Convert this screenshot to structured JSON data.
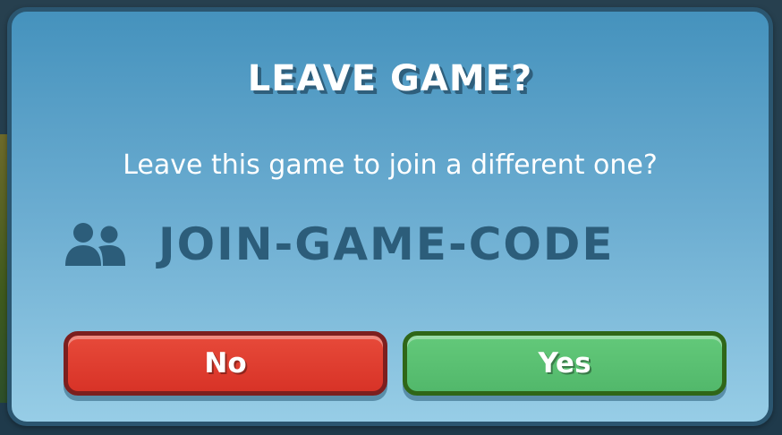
{
  "dialog": {
    "title": "LEAVE GAME?",
    "message": "Leave this game to join a different one?",
    "game_code": "JOIN-GAME-CODE",
    "code_icon": "players-icon",
    "no_label": "No",
    "yes_label": "Yes"
  },
  "colors": {
    "dialog_background": "#6cadd1",
    "dialog_border": "#2b5670",
    "game_code_text": "#2c5d7a",
    "no_button": "#d83327",
    "no_button_border": "#7c1f1f",
    "yes_button": "#52b86b",
    "yes_button_border": "#2f6618"
  }
}
